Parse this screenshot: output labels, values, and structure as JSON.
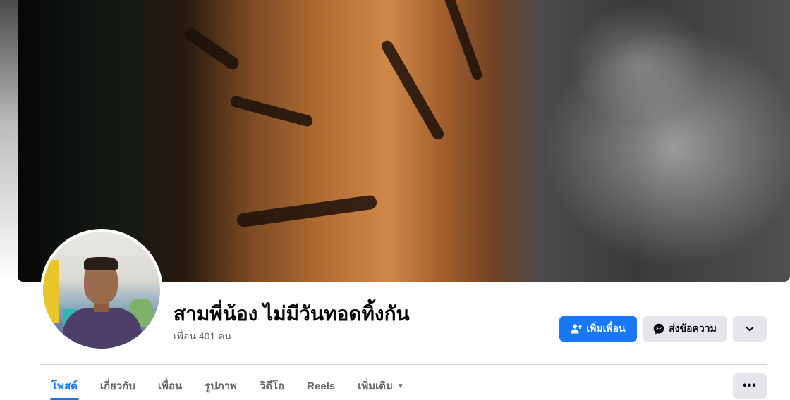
{
  "profile": {
    "name": "สามพี่น้อง ไม่มีวันทอดทิ้งกัน",
    "friends_count_label": "เพื่อน 401 คน"
  },
  "actions": {
    "add_friend_label": "เพิ่มเพื่อน",
    "message_label": "ส่งข้อความ"
  },
  "tabs": [
    {
      "label": "โพสต์",
      "active": true
    },
    {
      "label": "เกี่ยวกับ",
      "active": false
    },
    {
      "label": "เพื่อน",
      "active": false
    },
    {
      "label": "รูปภาพ",
      "active": false
    },
    {
      "label": "วิดีโอ",
      "active": false
    },
    {
      "label": "Reels",
      "active": false
    },
    {
      "label": "เพิ่มเติม",
      "active": false
    }
  ],
  "icons": {
    "add_friend": "add-friend-icon",
    "messenger": "messenger-icon",
    "chevron": "chevron-down-icon",
    "more": "more-options-icon",
    "caret": "caret-down-icon"
  },
  "colors": {
    "primary": "#1877f2",
    "secondary_bg": "#e4e6eb",
    "muted_text": "#65676b"
  }
}
